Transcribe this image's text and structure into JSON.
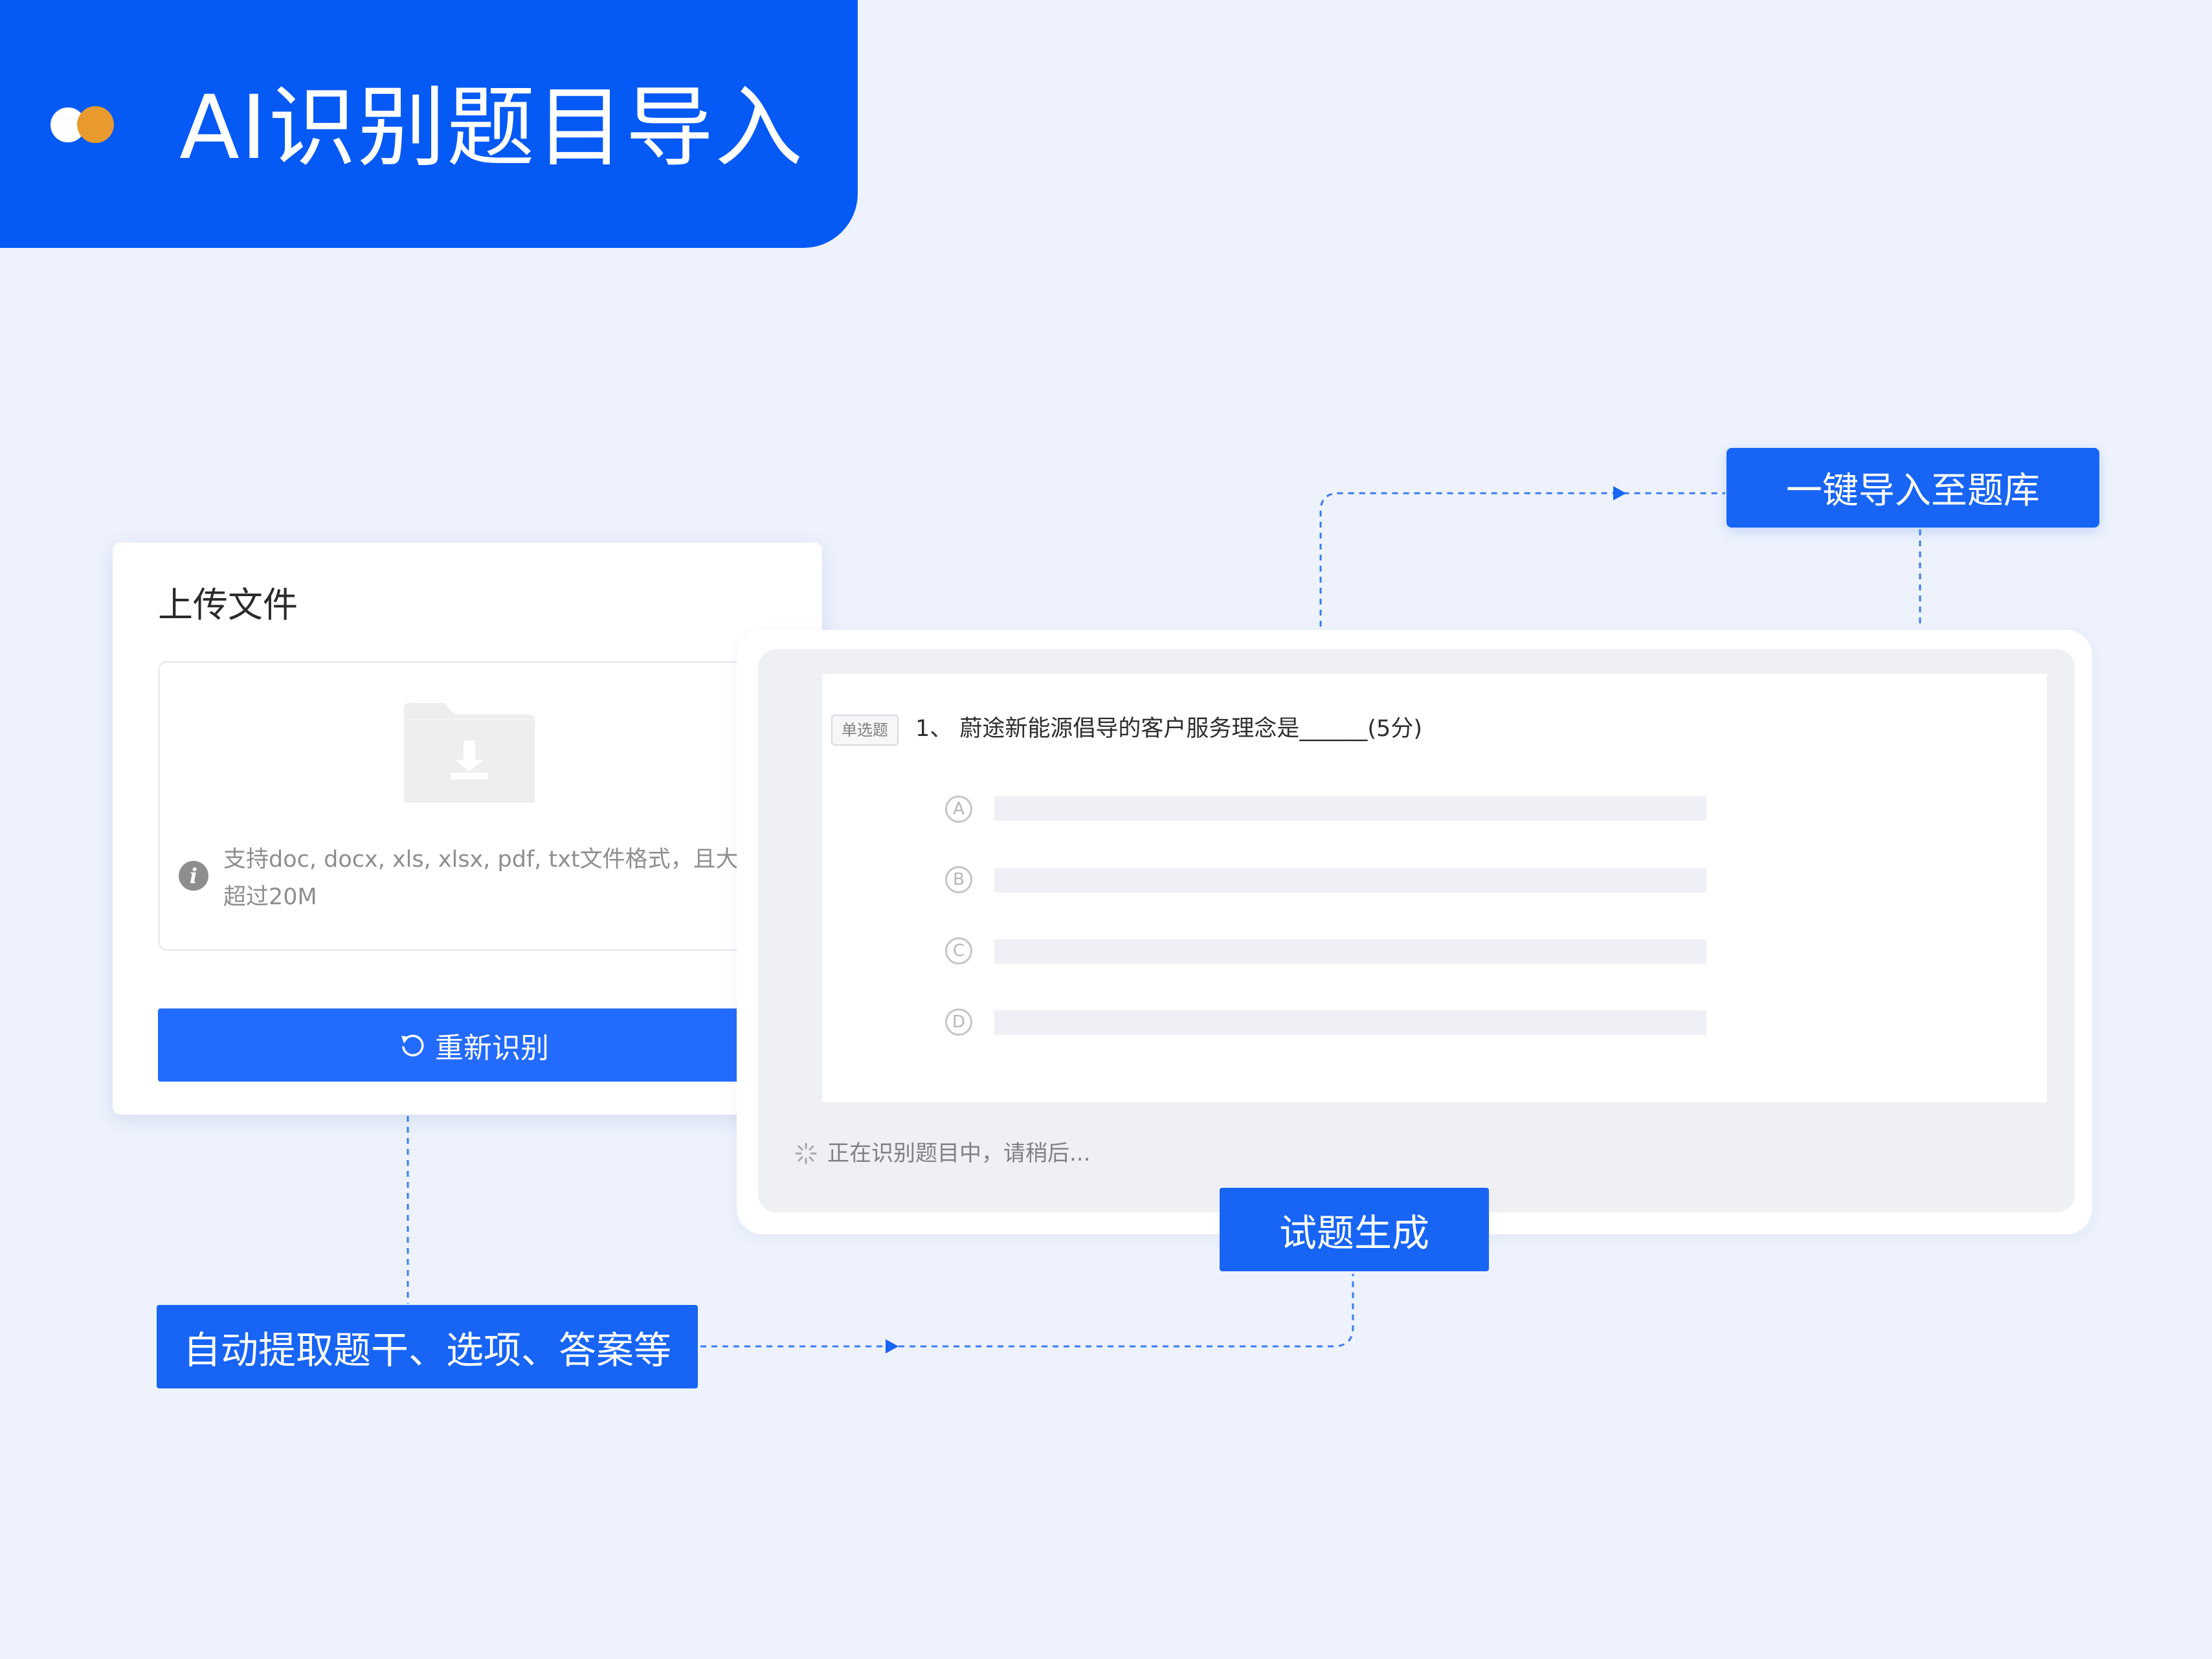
{
  "header": {
    "title": "AI识别题目导入"
  },
  "upload": {
    "title": "上传文件",
    "hint_line1": "支持doc, docx, xls, xlsx, pdf, txt文件格式，且大小不",
    "hint_line2": "超过20M",
    "reidentify_label": "重新识别"
  },
  "question": {
    "type_tag": "单选题",
    "text": "1、 蔚途新能源倡导的客户服务理念是______(5分)",
    "options": [
      "A",
      "B",
      "C",
      "D"
    ]
  },
  "status": {
    "text": "正在识别题目中，请稍后..."
  },
  "callouts": {
    "import": "一键导入至题库",
    "generate": "试题生成",
    "extract": "自动提取题干、选项、答案等"
  },
  "colors": {
    "brand_blue": "#0559F5",
    "button_blue": "#236BFE",
    "accent_orange": "#E89A2F",
    "background": "#EDF2FC"
  }
}
